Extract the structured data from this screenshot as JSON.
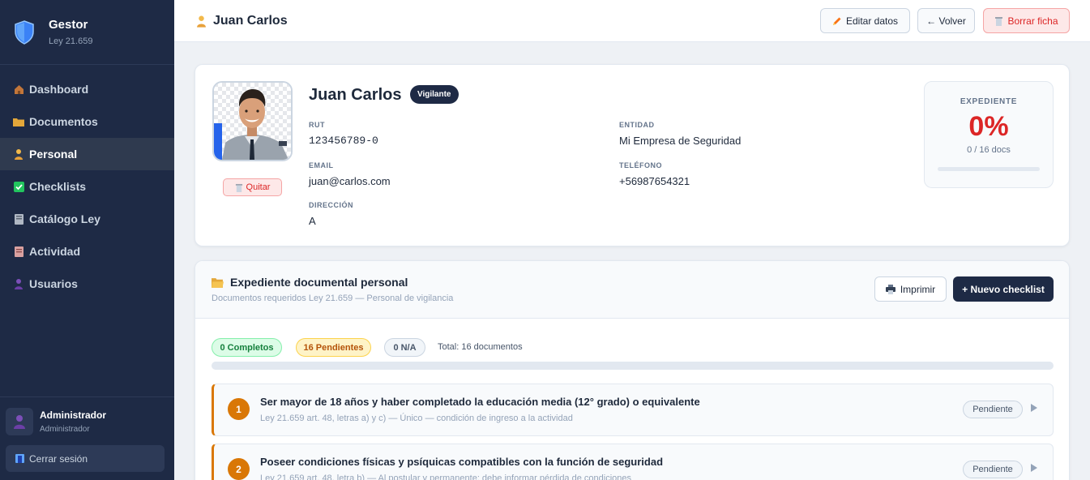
{
  "brand": {
    "title": "Gestor",
    "subtitle": "Ley 21.659"
  },
  "nav": [
    {
      "label": "Dashboard",
      "icon": "house-icon",
      "active": false
    },
    {
      "label": "Documentos",
      "icon": "folder-icon",
      "active": false
    },
    {
      "label": "Personal",
      "icon": "person-icon",
      "active": true
    },
    {
      "label": "Checklists",
      "icon": "checkbox-icon",
      "active": false
    },
    {
      "label": "Catálogo Ley",
      "icon": "book-icon",
      "active": false
    },
    {
      "label": "Actividad",
      "icon": "document-icon",
      "active": false
    },
    {
      "label": "Usuarios",
      "icon": "user-icon",
      "active": false
    }
  ],
  "user": {
    "name": "Administrador",
    "role": "Administrador",
    "logout": "Cerrar sesión"
  },
  "header": {
    "title": "Juan Carlos",
    "edit": "Editar datos",
    "back": "← Volver",
    "delete": "Borrar ficha"
  },
  "profile": {
    "name": "Juan Carlos",
    "role": "Vigilante",
    "remove_photo": "Quitar",
    "fields": {
      "rut_label": "RUT",
      "rut": "123456789-0",
      "entity_label": "ENTIDAD",
      "entity": "Mi Empresa de Seguridad",
      "email_label": "EMAIL",
      "email": "juan@carlos.com",
      "phone_label": "TELÉFONO",
      "phone": "+56987654321",
      "address_label": "DIRECCIÓN",
      "address": "A"
    },
    "expediente": {
      "label": "EXPEDIENTE",
      "percent": "0%",
      "docs": "0 / 16 docs",
      "progress": 0
    }
  },
  "section": {
    "title": "Expediente documental personal",
    "subtitle": "Documentos requeridos Ley 21.659 — Personal de vigilancia",
    "print": "Imprimir",
    "new_checklist": "+ Nuevo checklist",
    "summary": {
      "complete": "0 Completos",
      "pending": "16 Pendientes",
      "na": "0 N/A",
      "total": "Total: 16 documentos",
      "progress": 0
    },
    "items": [
      {
        "number": "1",
        "title": "Ser mayor de 18 años y haber completado la educación media (12° grado) o equivalente",
        "subtitle": "Ley 21.659 art. 48, letras a) y c) — Único — condición de ingreso a la actividad",
        "status": "Pendiente"
      },
      {
        "number": "2",
        "title": "Poseer condiciones físicas y psíquicas compatibles con la función de seguridad",
        "subtitle": "Ley 21.659 art. 48, letra b) — Al postular y permanente: debe informar pérdida de condiciones",
        "status": "Pendiente"
      }
    ]
  },
  "colors": {
    "sidebar": "#1e2a45",
    "accent_red": "#dc2626",
    "pending": "#d97706",
    "complete": "#16a34a"
  }
}
